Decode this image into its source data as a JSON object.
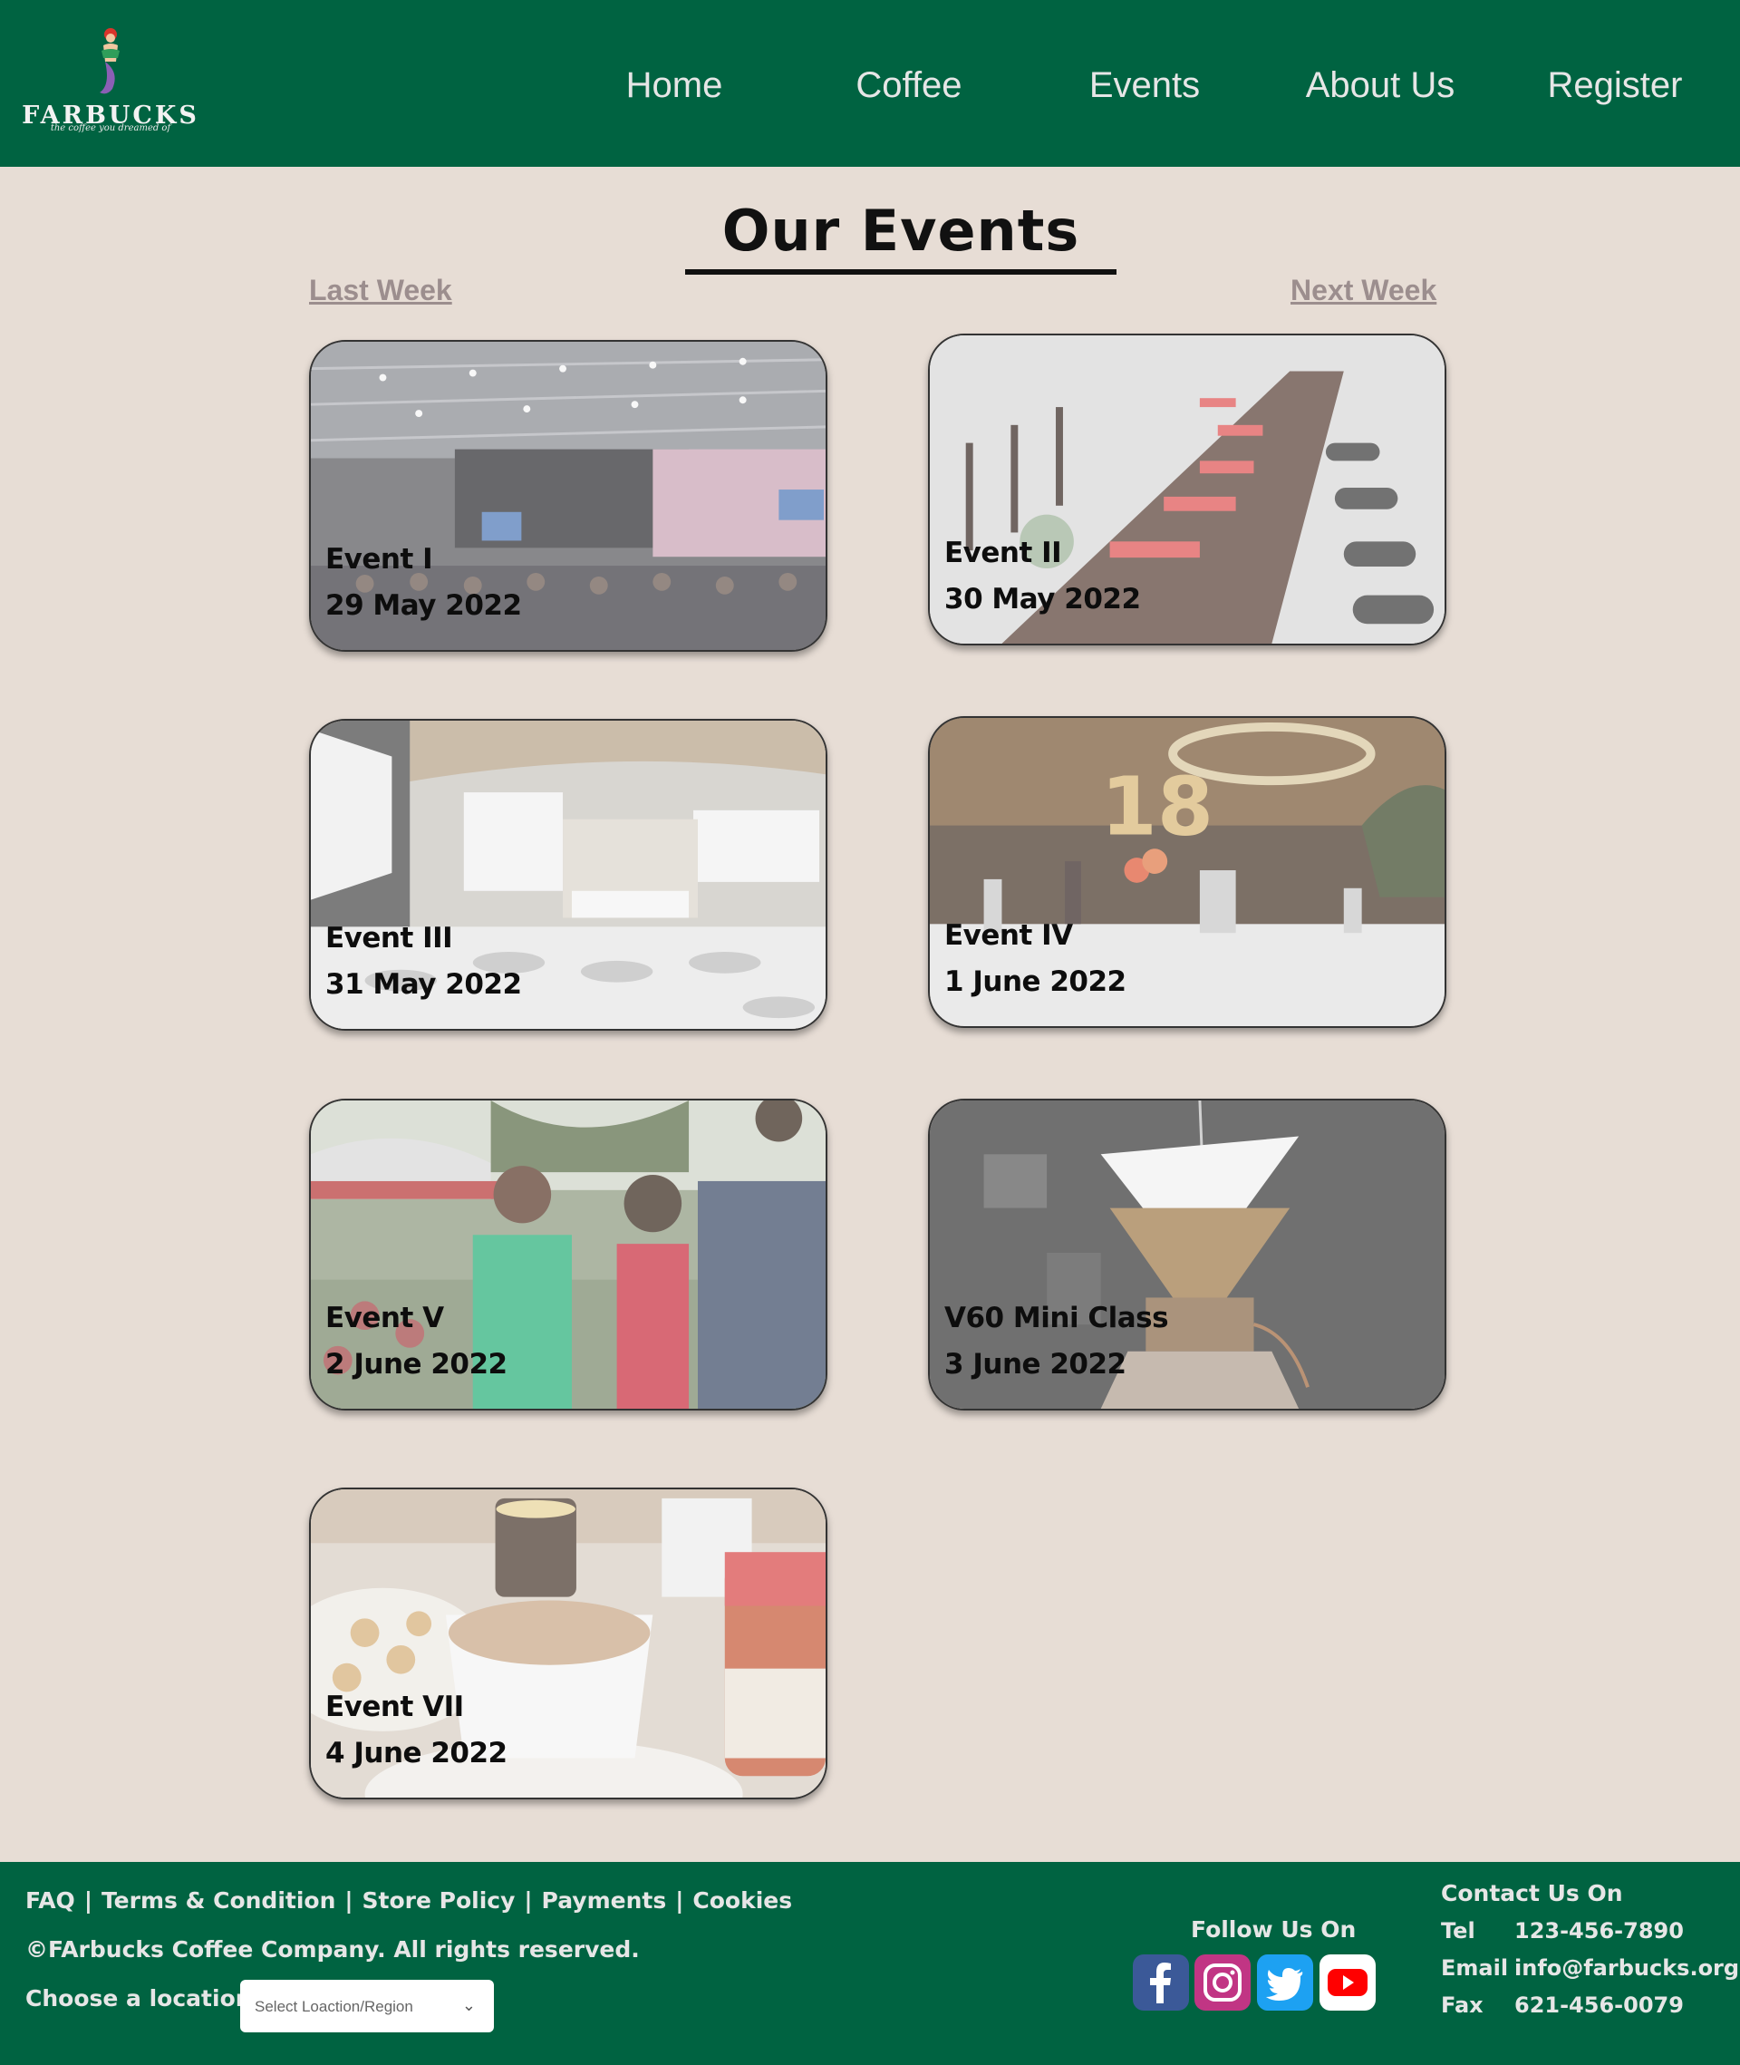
{
  "brand": {
    "name": "FARBUCKS",
    "tagline": "the coffee you dreamed of",
    "primary_color": "#006341",
    "background_color": "#e7ddd5"
  },
  "nav": {
    "items": [
      {
        "label": "Home"
      },
      {
        "label": "Coffee"
      },
      {
        "label": "Events"
      },
      {
        "label": "About Us"
      },
      {
        "label": "Register"
      }
    ]
  },
  "main": {
    "title": "Our Events",
    "prev_link": "Last Week",
    "next_link": "Next Week",
    "events": [
      {
        "name": "Event I",
        "date": "29 May 2022",
        "image": "conference-hall-photo"
      },
      {
        "name": "Event II",
        "date": "30 May 2022",
        "image": "outdoor-dinner-table-photo"
      },
      {
        "name": "Event III",
        "date": "31 May 2022",
        "image": "banquet-hall-photo"
      },
      {
        "name": "Event IV",
        "date": "1 June 2022",
        "image": "party-restaurant-photo"
      },
      {
        "name": "Event V",
        "date": "2 June 2022",
        "image": "garden-party-photo"
      },
      {
        "name": "V60 Mini Class",
        "date": "3 June 2022",
        "image": "pour-over-coffee-photo"
      },
      {
        "name": "Event VII",
        "date": "4 June 2022",
        "image": "coffee-cup-breakfast-photo"
      }
    ]
  },
  "footer": {
    "links": [
      "FAQ",
      "Terms & Condition",
      "Store Policy",
      "Payments",
      "Cookies"
    ],
    "separator": "|",
    "copyright": "©FArbucks Coffee Company. All rights reserved.",
    "location_label": "Choose a location :",
    "location_select": {
      "selected": "Select Loaction/Region",
      "icon": "chevron-down-icon"
    },
    "follow_label": "Follow Us On",
    "social": [
      {
        "name": "facebook-icon",
        "color": "#3b5998"
      },
      {
        "name": "instagram-icon",
        "color": "#c13584"
      },
      {
        "name": "twitter-icon",
        "color": "#1da1f2"
      },
      {
        "name": "youtube-icon",
        "color": "#ff0000"
      }
    ],
    "contact": {
      "title": "Contact Us On",
      "rows": [
        {
          "label": "Tel",
          "value": "123-456-7890"
        },
        {
          "label": "Email",
          "value": "info@farbucks.org"
        },
        {
          "label": "Fax",
          "value": "621-456-0079"
        }
      ]
    }
  }
}
